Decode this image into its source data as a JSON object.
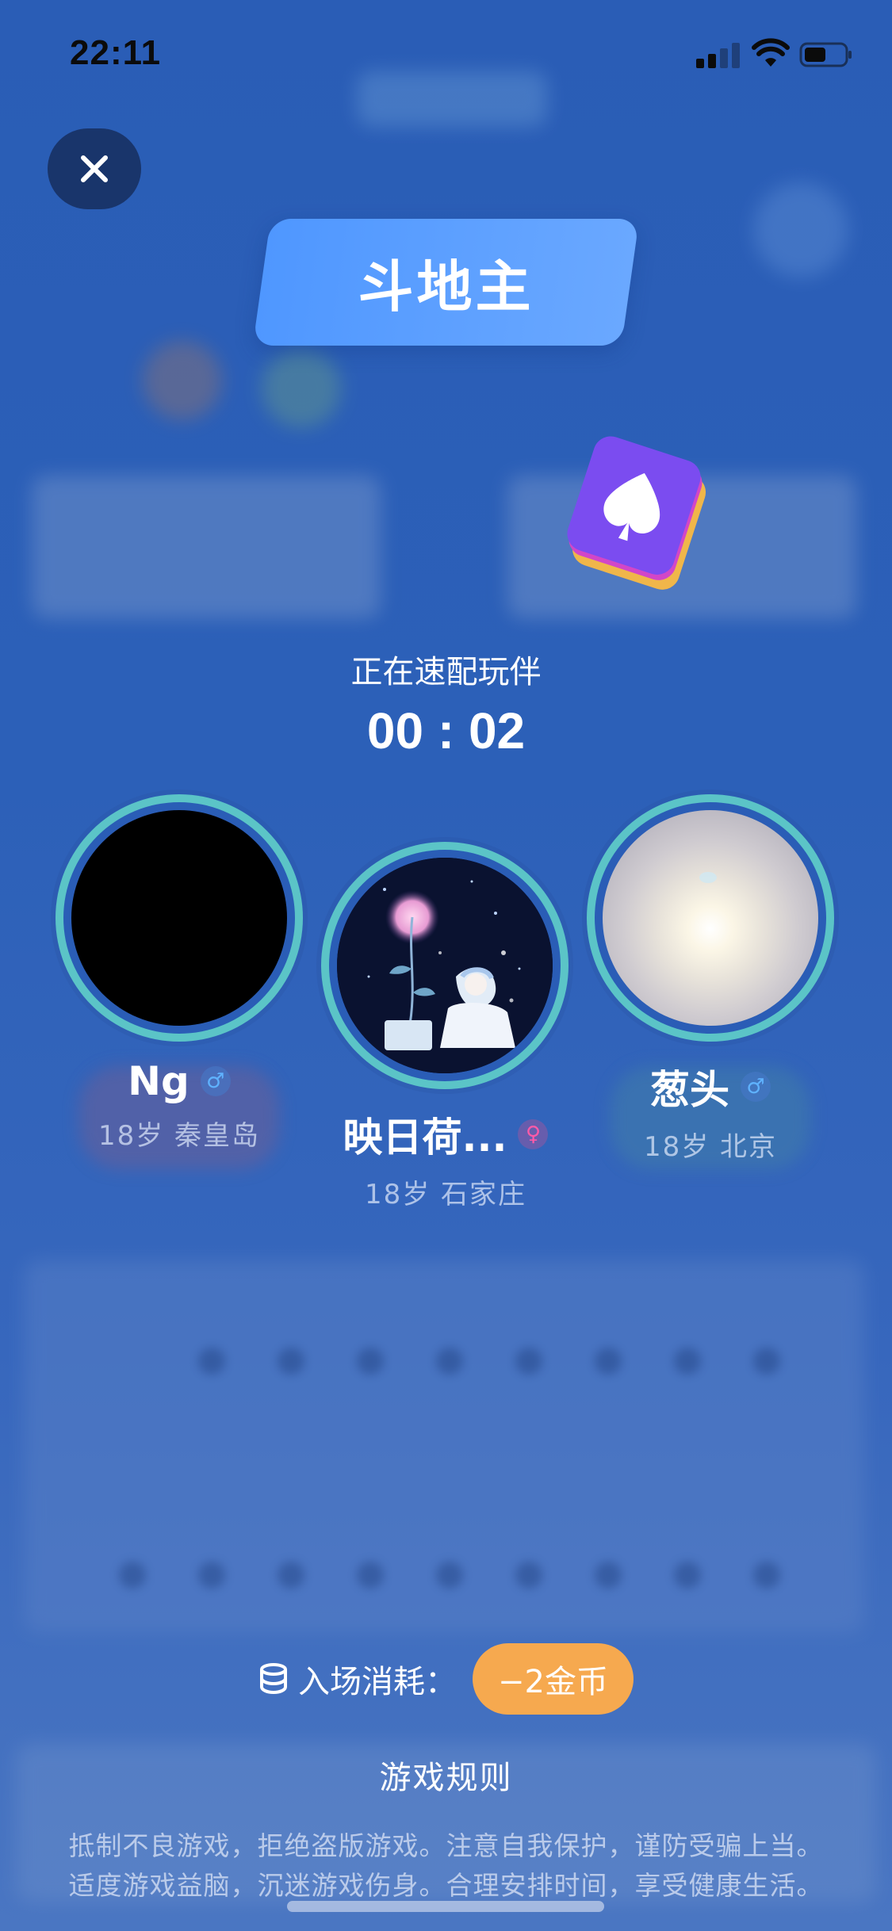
{
  "status_bar": {
    "time": "22:11",
    "icons": [
      "cellular-signal-icon",
      "wifi-icon",
      "battery-icon"
    ]
  },
  "close_button": {
    "icon": "close-icon"
  },
  "game": {
    "title": "斗地主",
    "icon": "spade-card-icon"
  },
  "matching": {
    "label": "正在速配玩伴",
    "timer": "00 : 02"
  },
  "players": [
    {
      "name": "Ng",
      "gender": "male",
      "gender_symbol": "♂",
      "info": "18岁 秦皇岛"
    },
    {
      "name": "映日荷...",
      "gender": "female",
      "gender_symbol": "♀",
      "info": "18岁 石家庄"
    },
    {
      "name": "葱头",
      "gender": "male",
      "gender_symbol": "♂",
      "info": "18岁 北京"
    }
  ],
  "entry_fee": {
    "icon": "coins-stack-icon",
    "label": "入场消耗：",
    "cost": "−2金币"
  },
  "rules_link": "游戏规则",
  "notice": {
    "line1": "抵制不良游戏，拒绝盗版游戏。注意自我保护，谨防受骗上当。",
    "line2": "适度游戏益脑，沉迷游戏伤身。合理安排时间，享受健康生活。"
  },
  "colors": {
    "background": "#2c60b8",
    "title_badge": "#5a9eff",
    "avatar_ring": "#5bc4c7",
    "cost_pill": "#f6a94f",
    "card_purple": "#7b4cf0"
  }
}
